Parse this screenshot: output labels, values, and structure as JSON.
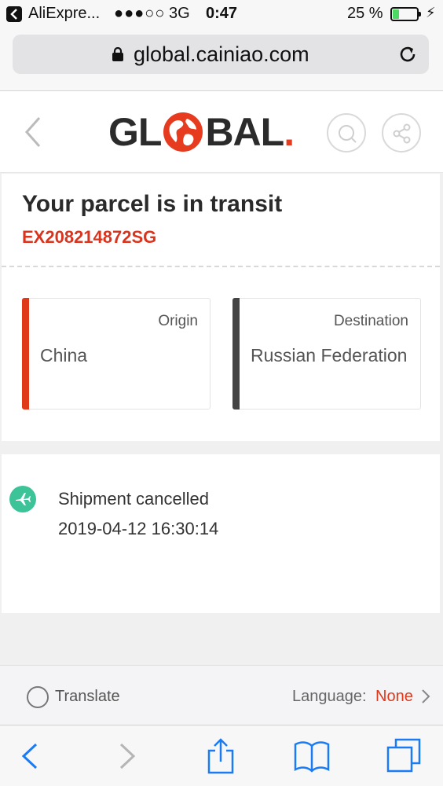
{
  "status_bar": {
    "app_name": "AliExpre...",
    "signal": "●●●○○",
    "network": "3G",
    "time": "0:47",
    "battery_percent": "25 %",
    "battery_level": 0.25
  },
  "browser": {
    "url": "global.cainiao.com"
  },
  "header": {
    "logo_left": "GL",
    "logo_right": "BAL",
    "logo_dot": "."
  },
  "parcel": {
    "status_title": "Your parcel is in transit",
    "tracking_number": "EX208214872SG",
    "origin_label": "Origin",
    "origin_value": "China",
    "destination_label": "Destination",
    "destination_value": "Russian Federation"
  },
  "events": [
    {
      "text": "Shipment cancelled",
      "time": "2019-04-12 16:30:14"
    }
  ],
  "translate_bar": {
    "translate_label": "Translate",
    "language_label": "Language:",
    "language_value": "None"
  },
  "colors": {
    "brand_red": "#e0391a",
    "event_green": "#3cc398",
    "ios_blue": "#1a7cf5"
  },
  "icons": {
    "back": "chevron-left-icon",
    "search": "search-icon",
    "share": "share-icon",
    "event": "airplane-icon",
    "reload": "reload-icon",
    "lock": "lock-icon"
  }
}
